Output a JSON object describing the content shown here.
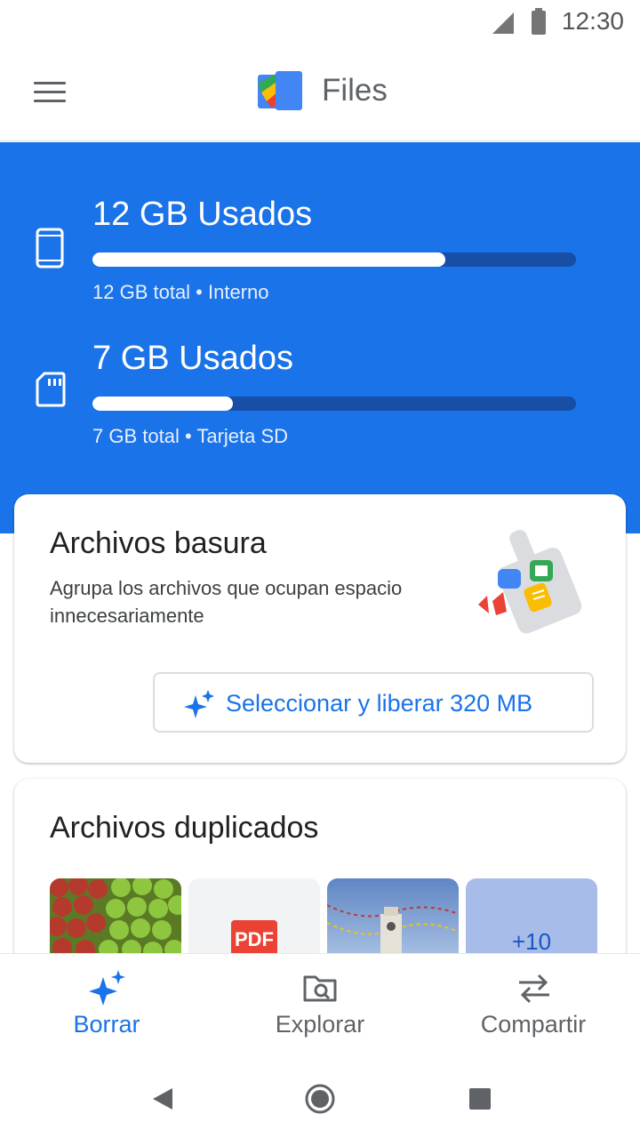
{
  "status_bar": {
    "time": "12:30"
  },
  "app_bar": {
    "title": "Files"
  },
  "storage": [
    {
      "used_label": "12 GB Usados",
      "detail": "12 GB total • Interno",
      "fill_fraction": 0.73
    },
    {
      "used_label": "7 GB Usados",
      "detail": "7 GB total • Tarjeta SD",
      "fill_fraction": 0.29
    }
  ],
  "junk_card": {
    "title": "Archivos basura",
    "description": "Agrupa los archivos que ocupan espacio  innecesariamente",
    "button_label": "Seleccionar y liberar 320 MB"
  },
  "duplicates_card": {
    "title": "Archivos duplicados",
    "thumbnails": [
      "apples",
      "pdf",
      "tower",
      "more"
    ],
    "pdf_label": "PDF",
    "more_count": "+10"
  },
  "bottom_nav": {
    "tabs": [
      {
        "label": "Borrar",
        "icon": "sparkle-icon",
        "active": true
      },
      {
        "label": "Explorar",
        "icon": "browse-folder-icon",
        "active": false
      },
      {
        "label": "Compartir",
        "icon": "swap-arrows-icon",
        "active": false
      }
    ]
  },
  "system_nav": {
    "buttons": [
      "back-icon",
      "home-icon",
      "recents-icon"
    ]
  },
  "colors": {
    "accent": "#1a73e8",
    "bar_track": "#174ea6",
    "text_primary": "#202124",
    "text_secondary": "#5f6368"
  }
}
